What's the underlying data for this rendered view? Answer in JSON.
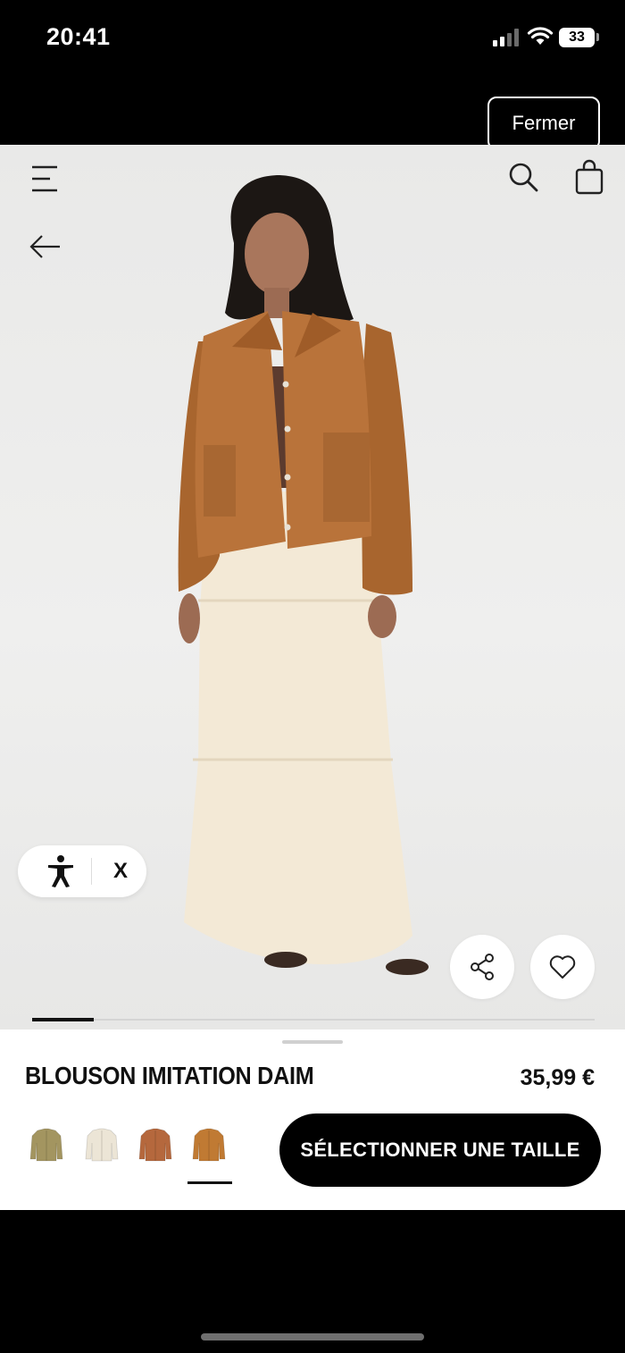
{
  "status_bar": {
    "time": "20:41",
    "battery": "33"
  },
  "top_bar": {
    "close_label": "Fermer"
  },
  "accessibility": {
    "close_label": "X"
  },
  "gallery": {
    "progress": 0.11
  },
  "product": {
    "name": "BLOUSON IMITATION DAIM",
    "price": "35,99 €",
    "select_size_label": "SÉLECTIONNER UNE TAILLE",
    "selected_swatch_index": 3,
    "swatches": [
      {
        "name": "khaki-jacket",
        "color": "#a39560"
      },
      {
        "name": "ecru-jacket",
        "color": "#ece5d6"
      },
      {
        "name": "rust-jacket",
        "color": "#b5683d"
      },
      {
        "name": "camel-jacket",
        "color": "#c07a33"
      }
    ]
  },
  "colors": {
    "jacket": "#b9733a",
    "skirt": "#f3e9d6",
    "top": "#5c3b2e",
    "accent": "#000000"
  }
}
